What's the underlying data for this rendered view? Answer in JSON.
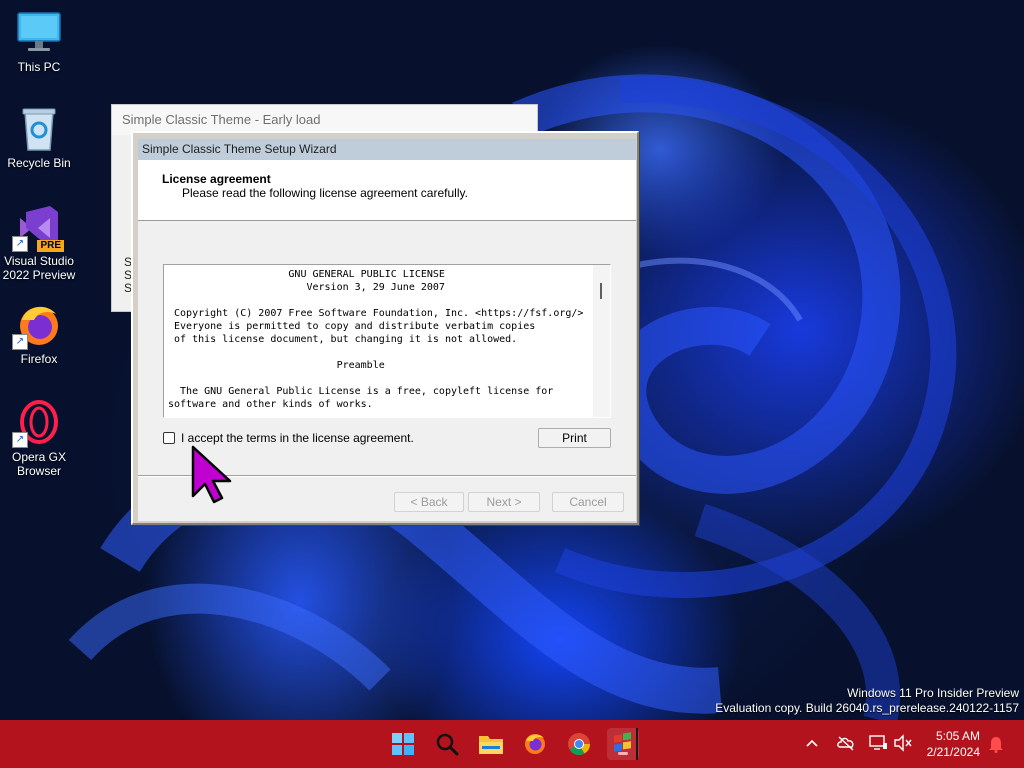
{
  "desktop_icons": [
    {
      "label": "This PC"
    },
    {
      "label": "Recycle Bin"
    },
    {
      "label": "Visual Studio 2022 Preview",
      "badge": "PRE"
    },
    {
      "label": "Firefox"
    },
    {
      "label": "Opera GX Browser"
    }
  ],
  "background_window": {
    "title": "Simple Classic Theme - Early load",
    "stub_chars": [
      "S",
      "S",
      "S"
    ]
  },
  "wizard": {
    "title": "Simple Classic Theme Setup Wizard",
    "header_title": "License agreement",
    "header_subtitle": "Please read the following license agreement carefully.",
    "license_text": "                    GNU GENERAL PUBLIC LICENSE\n                       Version 3, 29 June 2007\n\n Copyright (C) 2007 Free Software Foundation, Inc. <https://fsf.org/>\n Everyone is permitted to copy and distribute verbatim copies\n of this license document, but changing it is not allowed.\n\n                            Preamble\n\n  The GNU General Public License is a free, copyleft license for\nsoftware and other kinds of works.",
    "accept_label": "I accept the terms in the license agreement.",
    "accept_checked": false,
    "print_label": "Print",
    "back_label": "< Back",
    "next_label": "Next >",
    "cancel_label": "Cancel"
  },
  "watermark": {
    "line1": "Windows 11 Pro Insider Preview",
    "line2": "Evaluation copy. Build 26040.rs_prerelease.240122-1157"
  },
  "taskbar": {
    "apps": [
      "start-icon",
      "search-icon",
      "file-explorer-icon",
      "firefox-icon",
      "chrome-icon",
      "setup-wizard-icon"
    ],
    "tray_icons": [
      "chevron-up-icon",
      "onedrive-offline-icon",
      "network-icon",
      "volume-muted-icon",
      "notification-bell-icon"
    ],
    "time": "5:05 AM",
    "date": "2/21/2024"
  },
  "colors": {
    "taskbar": "#b3131c",
    "wizard_title_bar": "#bfcddb",
    "cursor": "#c000d0"
  }
}
